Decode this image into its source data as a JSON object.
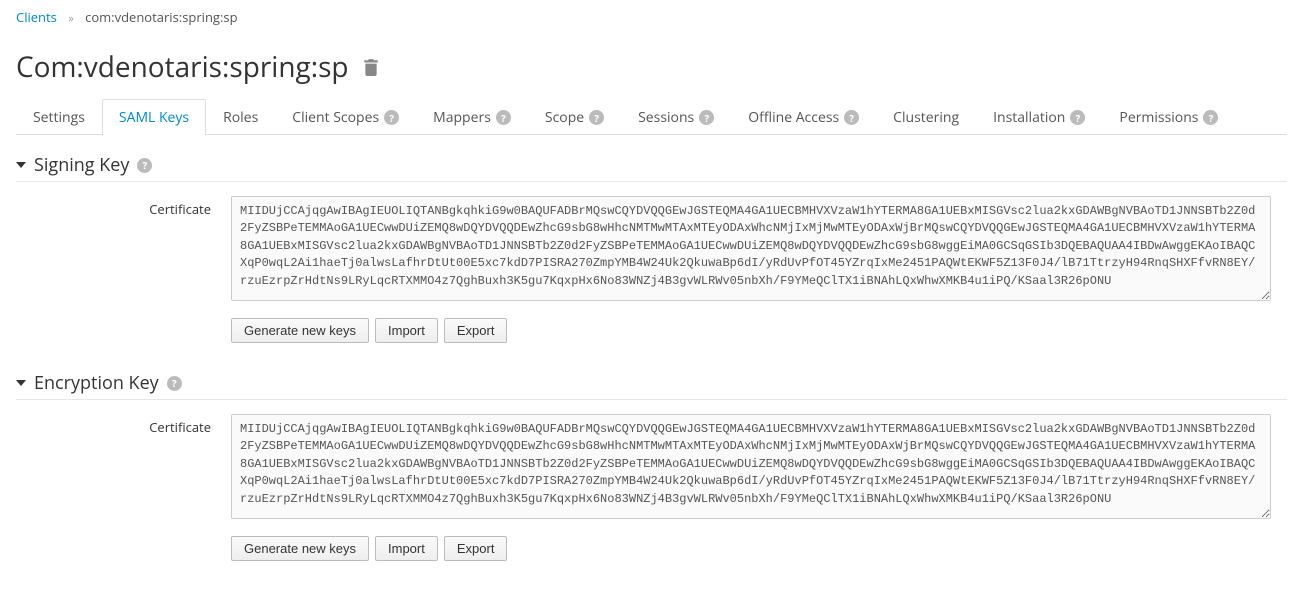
{
  "breadcrumb": {
    "clients": "Clients",
    "current": "com:vdenotaris:spring:sp"
  },
  "page_title": "Com:vdenotaris:spring:sp",
  "tabs": {
    "settings": "Settings",
    "saml_keys": "SAML Keys",
    "roles": "Roles",
    "client_scopes": "Client Scopes",
    "mappers": "Mappers",
    "scope": "Scope",
    "sessions": "Sessions",
    "offline_access": "Offline Access",
    "clustering": "Clustering",
    "installation": "Installation",
    "permissions": "Permissions"
  },
  "sections": {
    "signing": {
      "title": "Signing Key",
      "cert_label": "Certificate",
      "cert_value": "MIIDUjCCAjqgAwIBAgIEUOLIQTANBgkqhkiG9w0BAQUFADBrMQswCQYDVQQGEwJGSTEQMA4GA1UECBMHVXVzaW1hYTERMA8GA1UEBxMISGVsc2lua2kxGDAWBgNVBAoTD1JNNSBTb2Z0d2FyZSBPeTEMMAoGA1UECwwDUiZEMQ8wDQYDVQQDEwZhcG9sbG8wHhcNMTMwMTAxMTEyODAxWhcNMjIxMjMwMTEyODAxWjBrMQswCQYDVQQGEwJGSTEQMA4GA1UECBMHVXVzaW1hYTERMA8GA1UEBxMISGVsc2lua2kxGDAWBgNVBAoTD1JNNSBTb2Z0d2FyZSBPeTEMMAoGA1UECwwDUiZEMQ8wDQYDVQQDEwZhcG9sbG8wggEiMA0GCSqGSIb3DQEBAQUAA4IBDwAwggEKAoIBAQCXqP0wqL2Ai1haeTj0alwsLafhrDtUt00E5xc7kdD7PISRA270ZmpYMB4W24Uk2QkuwaBp6dI/yRdUvPfOT45YZrqIxMe2451PAQWtEKWF5Z13F0J4/lB71TtrzyH94RnqSHXFfvRN8EY/rzuEzrpZrHdtNs9LRyLqcRTXMMO4z7QghBuxh3K5gu7KqxpHx6No83WNZj4B3gvWLRWv05nbXh/F9YMeQClTX1iBNAhLQxWhwXMKB4u1iPQ/KSaal3R26pONU",
      "generate_btn": "Generate new keys",
      "import_btn": "Import",
      "export_btn": "Export"
    },
    "encryption": {
      "title": "Encryption Key",
      "cert_label": "Certificate",
      "cert_value": "MIIDUjCCAjqgAwIBAgIEUOLIQTANBgkqhkiG9w0BAQUFADBrMQswCQYDVQQGEwJGSTEQMA4GA1UECBMHVXVzaW1hYTERMA8GA1UEBxMISGVsc2lua2kxGDAWBgNVBAoTD1JNNSBTb2Z0d2FyZSBPeTEMMAoGA1UECwwDUiZEMQ8wDQYDVQQDEwZhcG9sbG8wHhcNMTMwMTAxMTEyODAxWhcNMjIxMjMwMTEyODAxWjBrMQswCQYDVQQGEwJGSTEQMA4GA1UECBMHVXVzaW1hYTERMA8GA1UEBxMISGVsc2lua2kxGDAWBgNVBAoTD1JNNSBTb2Z0d2FyZSBPeTEMMAoGA1UECwwDUiZEMQ8wDQYDVQQDEwZhcG9sbG8wggEiMA0GCSqGSIb3DQEBAQUAA4IBDwAwggEKAoIBAQCXqP0wqL2Ai1haeTj0alwsLafhrDtUt00E5xc7kdD7PISRA270ZmpYMB4W24Uk2QkuwaBp6dI/yRdUvPfOT45YZrqIxMe2451PAQWtEKWF5Z13F0J4/lB71TtrzyH94RnqSHXFfvRN8EY/rzuEzrpZrHdtNs9LRyLqcRTXMMO4z7QghBuxh3K5gu7KqxpHx6No83WNZj4B3gvWLRWv05nbXh/F9YMeQClTX1iBNAhLQxWhwXMKB4u1iPQ/KSaal3R26pONU",
      "generate_btn": "Generate new keys",
      "import_btn": "Import",
      "export_btn": "Export"
    }
  }
}
